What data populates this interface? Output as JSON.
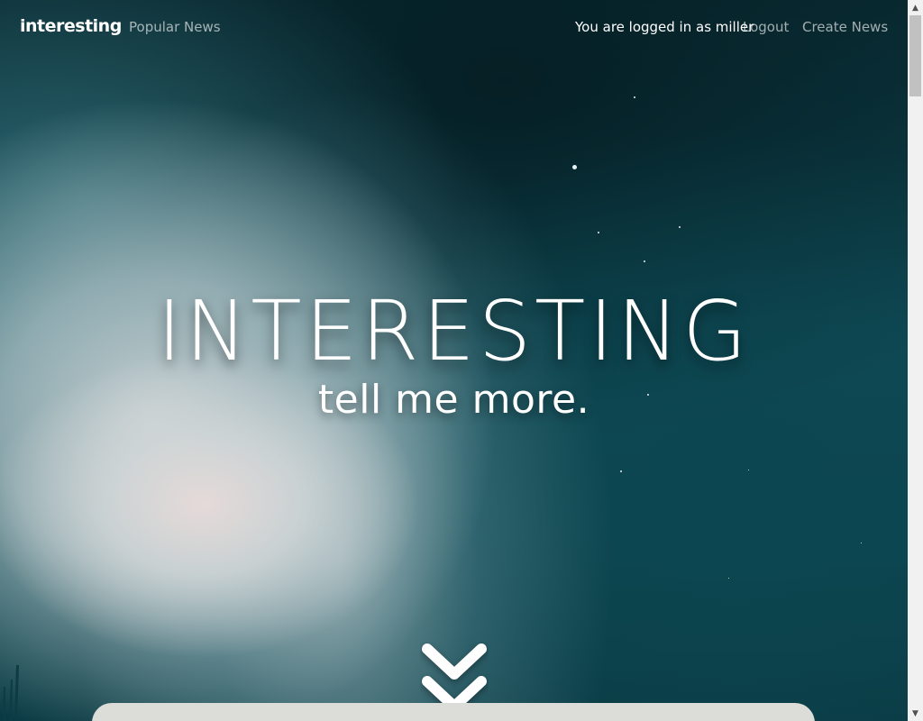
{
  "navbar": {
    "brand": "interesting",
    "popular_news": "Popular News",
    "logged_in_text": "You are logged in as miller",
    "logout": "Logout",
    "create_news": "Create News"
  },
  "hero": {
    "title": "INTERESTING",
    "subtitle": "tell me more."
  },
  "icons": {
    "scroll_down": "double-chevron-down-icon",
    "scrollbar_up": "triangle-up-icon",
    "scrollbar_down": "triangle-down-icon"
  },
  "colors": {
    "text": "#ffffff",
    "nav_muted": "rgba(255,255,255,0.62)",
    "card": "#dcdcd8",
    "sky_dark": "#0a2d35",
    "sky_teal": "#0f4a55"
  }
}
